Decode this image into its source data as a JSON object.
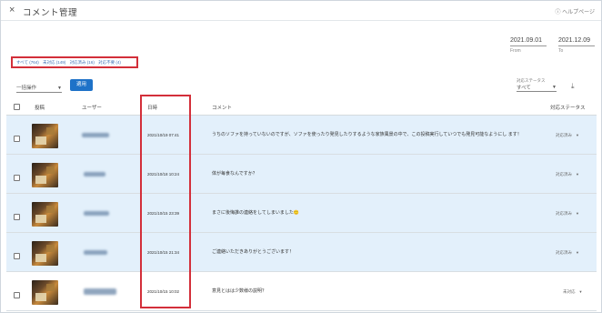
{
  "header": {
    "close_icon": "×",
    "title": "コメント管理",
    "help": "ⓘ ヘルプページ"
  },
  "date_range": {
    "from_date": "2021.09.01",
    "from_label": "From",
    "to_date": "2021.12.09",
    "to_label": "To"
  },
  "status_filters": [
    "すべて (764)",
    "未対応 (149)",
    "対応済み (16)",
    "対応不要 (4)"
  ],
  "toolbar": {
    "bulk_label": "一括操作",
    "apply_label": "適用",
    "response_filter_label": "対応ステータス",
    "response_filter_value": "すべて"
  },
  "table": {
    "headers": {
      "post": "投稿",
      "user": "ユーザー",
      "date": "日時",
      "comment": "コメント",
      "status": "対応ステータス"
    },
    "rows": [
      {
        "date": "2021/10/19 07:41",
        "comment": "うちのソファを持っていないのですが、ソファを使ったり発見したりするような家族風景の中で、この投稿実行していつでも発見可能なようにし ます！",
        "status": "対応済み",
        "selected": true
      },
      {
        "date": "2021/10/18 10:24",
        "comment": "体が毎食なんですか？",
        "status": "対応済み",
        "selected": true
      },
      {
        "date": "2021/10/15 23:39",
        "comment": "まさに後悔誰の連絡をしてしまいました🙂",
        "status": "対応済み",
        "selected": true
      },
      {
        "date": "2021/10/15 21:34",
        "comment": "ご連絡いただきありがとうございます！",
        "status": "対応済み",
        "selected": true
      },
      {
        "date": "2021/10/15 10:02",
        "comment": "意見とはは少数様の説明？",
        "status": "未対応",
        "selected": false
      }
    ]
  },
  "colors": {
    "accent": "#1e72c8",
    "highlight_border": "#d32f3a",
    "selected_row": "#e3f0fb"
  }
}
